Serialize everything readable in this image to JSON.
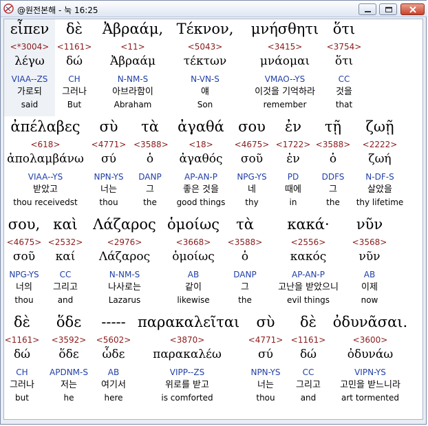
{
  "window": {
    "title": "@원전본해 - 눅 16:25"
  },
  "rows": [
    {
      "words": [
        {
          "greek": "εἶπεν",
          "strong": "<*3004>",
          "lemma": "λέγω",
          "parsing": "VIAA--ZS",
          "korean": "가로되",
          "english": "said"
        },
        {
          "greek": "δὲ",
          "strong": "<1161>",
          "lemma": "δώ",
          "parsing": "CH",
          "korean": "그러나",
          "english": "But"
        },
        {
          "greek": "Ἀβραάμ,",
          "strong": "<11>",
          "lemma": "Ἀβραάμ",
          "parsing": "N-NM-S",
          "korean": "아브라함이",
          "english": "Abraham"
        },
        {
          "greek": "Τέκνον,",
          "strong": "<5043>",
          "lemma": "τέκτων",
          "parsing": "N-VN-S",
          "korean": "얘",
          "english": "Son"
        },
        {
          "greek": "μνήσθητι",
          "strong": "<3415>",
          "lemma": "μνάομαι",
          "parsing": "VMAO--YS",
          "korean": "이것을 기억하라",
          "english": "remember"
        },
        {
          "greek": "ὅτι",
          "strong": "<3754>",
          "lemma": "ὅτι",
          "parsing": "CC",
          "korean": "것을",
          "english": "that"
        }
      ]
    },
    {
      "words": [
        {
          "greek": "ἀπέλαβες",
          "strong": "<618>",
          "lemma": "ἀπολαμβάνω",
          "parsing": "VIAA--YS",
          "korean": "받았고",
          "english": "thou receivedst"
        },
        {
          "greek": "σὺ",
          "strong": "<4771>",
          "lemma": "σύ",
          "parsing": "NPN-YS",
          "korean": "너는",
          "english": "thou"
        },
        {
          "greek": "τὰ",
          "strong": "<3588>",
          "lemma": "ὁ",
          "parsing": "DANP",
          "korean": "그",
          "english": "the"
        },
        {
          "greek": "ἀγαθά",
          "strong": "<18>",
          "lemma": "ἀγαθός",
          "parsing": "AP-AN-P",
          "korean": "좋은 것을",
          "english": "good things"
        },
        {
          "greek": "σου",
          "strong": "<4675>",
          "lemma": "σοῦ",
          "parsing": "NPG-YS",
          "korean": "네",
          "english": "thy"
        },
        {
          "greek": "ἐν",
          "strong": "<1722>",
          "lemma": "ἐν",
          "parsing": "PD",
          "korean": "때에",
          "english": "in"
        },
        {
          "greek": "τῇ",
          "strong": "<3588>",
          "lemma": "ὁ",
          "parsing": "DDFS",
          "korean": "그",
          "english": "the"
        },
        {
          "greek": "ζωῇ",
          "strong": "<2222>",
          "lemma": "ζωή",
          "parsing": "N-DF-S",
          "korean": "살았을",
          "english": "thy lifetime"
        }
      ]
    },
    {
      "words": [
        {
          "greek": "σου,",
          "strong": "<4675>",
          "lemma": "σοῦ",
          "parsing": "NPG-YS",
          "korean": "너의",
          "english": "thou"
        },
        {
          "greek": "καὶ",
          "strong": "<2532>",
          "lemma": "καί",
          "parsing": "CC",
          "korean": "그리고",
          "english": "and"
        },
        {
          "greek": "Λάζαρος",
          "strong": "<2976>",
          "lemma": "Λάζαρος",
          "parsing": "N-NM-S",
          "korean": "나사로는",
          "english": "Lazarus"
        },
        {
          "greek": "ὁμοίως",
          "strong": "<3668>",
          "lemma": "ὁμοίως",
          "parsing": "AB",
          "korean": "같이",
          "english": "likewise"
        },
        {
          "greek": "τὰ",
          "strong": "<3588>",
          "lemma": "ὁ",
          "parsing": "DANP",
          "korean": "그",
          "english": "the"
        },
        {
          "greek": "κακά·",
          "strong": "<2556>",
          "lemma": "κακός",
          "parsing": "AP-AN-P",
          "korean": "고난을 받았으니",
          "english": "evil things"
        },
        {
          "greek": "νῦν",
          "strong": "<3568>",
          "lemma": "νῦν",
          "parsing": "AB",
          "korean": "이제",
          "english": "now"
        }
      ]
    },
    {
      "words": [
        {
          "greek": "δὲ",
          "strong": "<1161>",
          "lemma": "δώ",
          "parsing": "CH",
          "korean": "그러나",
          "english": "but"
        },
        {
          "greek": "ὅδε",
          "strong": "<3592>",
          "lemma": "ὅδε",
          "parsing": "APDNM-S",
          "korean": "저는",
          "english": "he"
        },
        {
          "greek": "-----",
          "strong": "<5602>",
          "lemma": "ὧδε",
          "parsing": "AB",
          "korean": "여기서",
          "english": "here"
        },
        {
          "greek": "παρακαλεῖται",
          "strong": "<3870>",
          "lemma": "παρακαλέω",
          "parsing": "VIPP--ZS",
          "korean": "위로를 받고",
          "english": "is comforted"
        },
        {
          "greek": "σὺ",
          "strong": "<4771>",
          "lemma": "σύ",
          "parsing": "NPN-YS",
          "korean": "너는",
          "english": "thou"
        },
        {
          "greek": "δὲ",
          "strong": "<1161>",
          "lemma": "δώ",
          "parsing": "CC",
          "korean": "그리고",
          "english": "and"
        },
        {
          "greek": "ὀδυνᾶσαι.",
          "strong": "<3600>",
          "lemma": "ὀδυνάω",
          "parsing": "VIPN-YS",
          "korean": "고민을 받느니라",
          "english": "art tormented"
        }
      ]
    }
  ]
}
